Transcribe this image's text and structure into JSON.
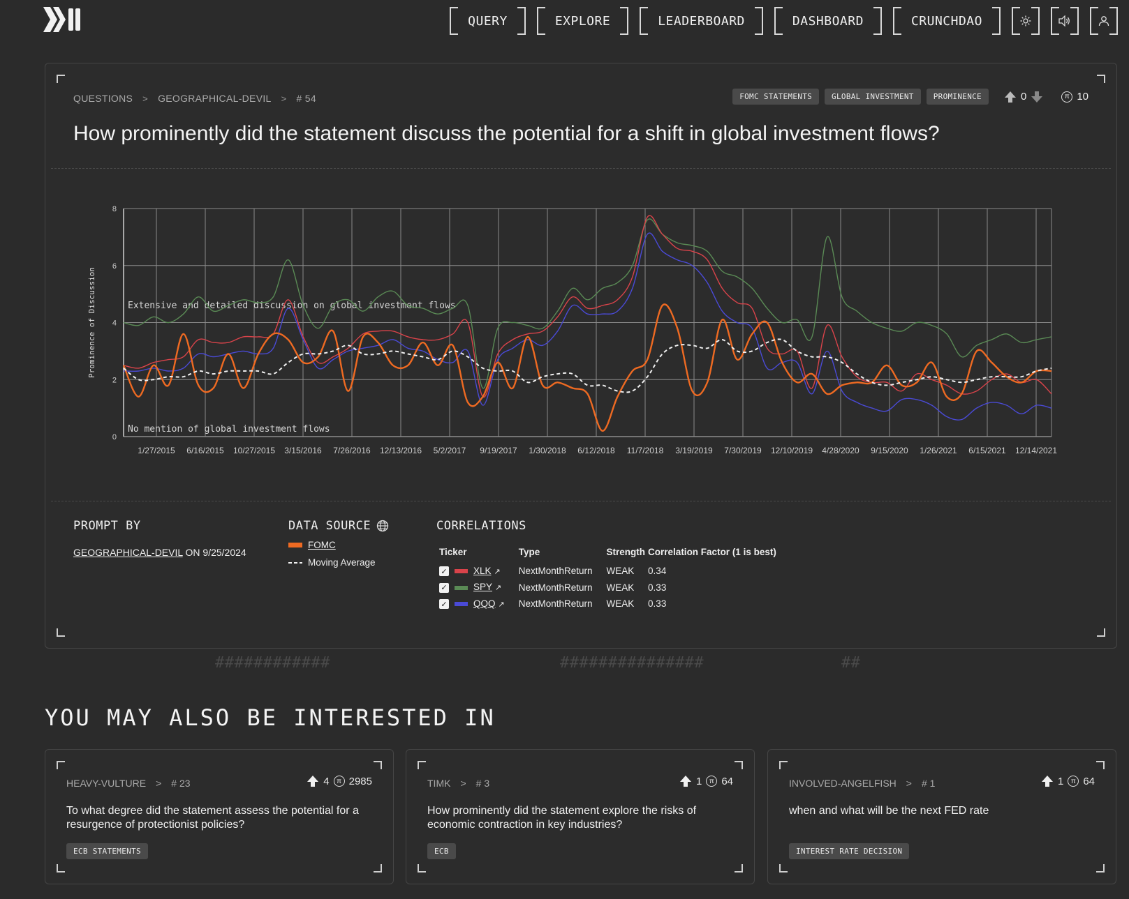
{
  "nav": {
    "items": [
      "QUERY",
      "EXPLORE",
      "LEADERBOARD",
      "DASHBOARD",
      "CRUNCHDAO"
    ],
    "icons": [
      "sun-icon",
      "speaker-icon",
      "user-icon"
    ]
  },
  "question": {
    "breadcrumb": [
      "QUESTIONS",
      "GEOGRAPHICAL-DEVIL",
      "# 54"
    ],
    "tags": [
      "FOMC STATEMENTS",
      "GLOBAL INVESTMENT",
      "PROMINENCE"
    ],
    "votes": "0",
    "pi_score": "10",
    "title": "How prominently did the statement discuss the potential for a shift in global investment flows?"
  },
  "chart_data": {
    "type": "line",
    "ylabel": "Prominence of Discussion",
    "ylim": [
      0,
      8
    ],
    "yticks": [
      0,
      2,
      4,
      6,
      8
    ],
    "x_tick_labels": [
      "1/27/2015",
      "6/16/2015",
      "10/27/2015",
      "3/15/2016",
      "7/26/2016",
      "12/13/2016",
      "5/2/2017",
      "9/19/2017",
      "1/30/2018",
      "6/12/2018",
      "11/7/2018",
      "3/19/2019",
      "7/30/2019",
      "12/10/2019",
      "4/28/2020",
      "9/15/2020",
      "1/26/2021",
      "6/15/2021",
      "12/14/2021"
    ],
    "annotations": [
      "Extensive and detailed discussion on global investment flows",
      "No mention of global investment flows"
    ],
    "grid": true,
    "series": [
      {
        "name": "SPY",
        "color": "#5a8a55",
        "values": [
          4.0,
          3.9,
          4.2,
          4.0,
          4.3,
          4.9,
          4.4,
          4.6,
          4.8,
          4.7,
          4.9,
          6.2,
          4.6,
          3.8,
          4.6,
          4.8,
          4.4,
          4.9,
          5.1,
          4.6,
          4.5,
          4.3,
          4.5,
          4.6,
          1.7,
          3.8,
          4.0,
          3.9,
          3.8,
          4.4,
          5.2,
          4.8,
          5.2,
          5.4,
          6.0,
          7.6,
          7.1,
          6.8,
          6.7,
          6.5,
          5.8,
          5.6,
          5.2,
          4.5,
          4.0,
          4.1,
          3.5,
          7.0,
          4.9,
          4.4,
          4.0,
          3.8,
          3.7,
          4.0,
          3.9,
          3.6,
          2.8,
          3.2,
          3.4,
          3.6,
          3.3,
          3.4,
          3.5
        ]
      },
      {
        "name": "XLK",
        "color": "#d9434a",
        "values": [
          2.5,
          2.4,
          2.6,
          2.7,
          2.8,
          3.4,
          3.3,
          3.3,
          3.5,
          3.5,
          3.6,
          4.8,
          3.5,
          2.6,
          2.8,
          3.1,
          3.6,
          3.7,
          3.7,
          3.5,
          3.4,
          3.4,
          3.6,
          4.0,
          1.4,
          2.9,
          3.4,
          3.6,
          3.7,
          4.2,
          4.9,
          4.5,
          4.6,
          4.8,
          5.6,
          7.7,
          7.1,
          6.6,
          6.5,
          6.2,
          5.2,
          4.7,
          4.5,
          3.1,
          2.9,
          3.0,
          1.7,
          3.9,
          2.8,
          2.1,
          1.9,
          1.9,
          1.6,
          2.2,
          2.0,
          1.8,
          1.5,
          1.6,
          2.0,
          2.2,
          1.9,
          2.0,
          1.5
        ]
      },
      {
        "name": "QQQ",
        "color": "#4a4ad6",
        "values": [
          2.3,
          2.3,
          2.4,
          2.3,
          2.4,
          2.9,
          2.8,
          2.9,
          3.0,
          2.9,
          3.1,
          4.5,
          3.4,
          2.4,
          2.7,
          3.0,
          3.1,
          3.2,
          3.4,
          3.1,
          3.0,
          2.7,
          2.6,
          3.0,
          1.1,
          2.7,
          3.1,
          3.4,
          3.2,
          3.7,
          4.6,
          4.3,
          4.3,
          4.4,
          5.2,
          7.1,
          6.5,
          6.2,
          6.0,
          5.4,
          4.4,
          4.0,
          3.8,
          2.4,
          2.6,
          2.6,
          1.5,
          3.0,
          1.6,
          1.2,
          1.0,
          0.9,
          1.3,
          1.3,
          1.1,
          0.7,
          0.6,
          1.0,
          1.2,
          1.1,
          0.8,
          1.1,
          1.0
        ]
      },
      {
        "name": "FOMC",
        "color": "#ee6a22",
        "values": [
          2.5,
          1.4,
          2.5,
          1.8,
          3.6,
          1.8,
          1.7,
          2.9,
          1.7,
          2.9,
          3.6,
          3.4,
          2.6,
          2.8,
          3.7,
          1.6,
          3.5,
          3.3,
          2.5,
          2.5,
          3.3,
          2.5,
          3.2,
          1.2,
          1.4,
          2.6,
          1.7,
          3.5,
          1.8,
          1.9,
          1.7,
          1.5,
          0.2,
          1.4,
          2.3,
          2.7,
          4.6,
          3.8,
          1.6,
          1.9,
          4.1,
          2.7,
          3.6,
          4.0,
          2.6,
          1.9,
          2.2,
          1.5,
          1.8,
          1.9,
          1.9,
          2.5,
          1.8,
          1.9,
          2.6,
          1.4,
          1.5,
          3.0,
          2.6,
          2.1,
          1.9,
          2.3,
          2.3
        ]
      },
      {
        "name": "Moving Average",
        "color": "#f0f0f0",
        "values": [
          2.4,
          2.0,
          2.0,
          2.1,
          2.1,
          2.3,
          2.2,
          2.3,
          2.3,
          2.3,
          2.2,
          2.6,
          2.9,
          2.9,
          3.0,
          3.2,
          2.9,
          2.9,
          3.0,
          2.9,
          2.8,
          2.7,
          3.0,
          2.8,
          2.4,
          2.3,
          2.3,
          1.9,
          2.1,
          2.2,
          2.2,
          1.8,
          1.8,
          1.6,
          1.6,
          2.1,
          2.9,
          3.2,
          3.2,
          3.1,
          3.4,
          3.0,
          3.0,
          3.3,
          3.4,
          3.0,
          2.8,
          2.8,
          2.6,
          2.2,
          1.9,
          1.8,
          1.9,
          2.0,
          2.1,
          2.0,
          1.9,
          2.0,
          2.1,
          2.1,
          2.1,
          2.3,
          2.4
        ]
      }
    ]
  },
  "prompt_by": {
    "label": "PROMPT BY",
    "author": "GEOGRAPHICAL-DEVIL",
    "on_text": "ON 9/25/2024"
  },
  "data_source": {
    "label": "DATA SOURCE",
    "items": [
      {
        "name": "FOMC",
        "color": "#ee6a22"
      },
      {
        "name": "Moving Average",
        "color": "#f0f0f0"
      }
    ]
  },
  "correlations": {
    "label": "CORRELATIONS",
    "headers": [
      "Ticker",
      "Type",
      "Strength",
      "Correlation Factor (1 is best)"
    ],
    "rows": [
      {
        "ticker": "XLK",
        "color": "#d9434a",
        "type": "NextMonthReturn",
        "strength": "WEAK",
        "factor": "0.34"
      },
      {
        "ticker": "SPY",
        "color": "#5a8a55",
        "type": "NextMonthReturn",
        "strength": "WEAK",
        "factor": "0.33"
      },
      {
        "ticker": "QQQ",
        "color": "#4a4ad6",
        "type": "NextMonthReturn",
        "strength": "WEAK",
        "factor": "0.33"
      }
    ]
  },
  "hashes": [
    "############",
    "###############",
    "##"
  ],
  "related": {
    "title": "YOU MAY ALSO BE INTERESTED IN",
    "cards": [
      {
        "author": "HEAVY-VULTURE",
        "num": "# 23",
        "votes": "4",
        "pi": "2985",
        "question": "To what degree did the statement assess the potential for a resurgence of protectionist policies?",
        "tag": "ECB STATEMENTS"
      },
      {
        "author": "TIMK",
        "num": "# 3",
        "votes": "1",
        "pi": "64",
        "question": "How prominently did the statement explore the risks of economic contraction in key industries?",
        "tag": "ECB"
      },
      {
        "author": "INVOLVED-ANGELFISH",
        "num": "# 1",
        "votes": "1",
        "pi": "64",
        "question": "when and what will be the next FED rate",
        "tag": "INTEREST RATE DECISION"
      }
    ]
  }
}
